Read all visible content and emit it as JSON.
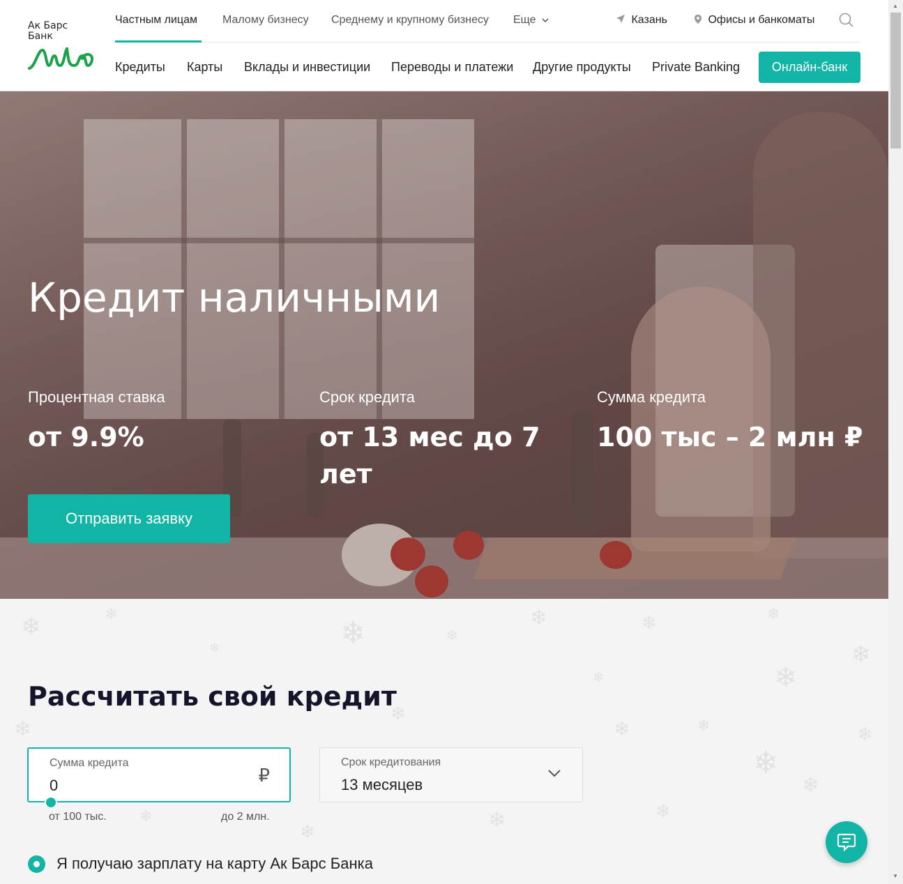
{
  "logo": {
    "line1": "Ак Барс",
    "line2": "Банк"
  },
  "top_nav": {
    "items": [
      "Частным лицам",
      "Малому бизнесу",
      "Среднему и крупному бизнесу",
      "Еще"
    ],
    "city": "Казань",
    "offices": "Офисы и банкоматы"
  },
  "main_nav": {
    "items": [
      "Кредиты",
      "Карты",
      "Вклады и инвестиции",
      "Переводы и платежи",
      "Другие продукты",
      "Private Banking"
    ],
    "online_bank": "Онлайн-банк"
  },
  "hero": {
    "title": "Кредит наличными",
    "stats": [
      {
        "label": "Процентная ставка",
        "value": "от 9.9%"
      },
      {
        "label": "Срок кредита",
        "value": "от 13 мес до 7 лет"
      },
      {
        "label": "Сумма кредита",
        "value": "100 тыс – 2 млн ₽"
      }
    ],
    "apply_button": "Отправить заявку"
  },
  "calculator": {
    "title": "Рассчитать свой кредит",
    "sum_label": "Сумма кредита",
    "sum_value": "0",
    "currency": "₽",
    "term_label": "Срок кредитования",
    "term_value": "13 месяцев",
    "range_min": "от 100 тыс.",
    "range_max": "до 2 млн.",
    "salary_option": "Я получаю зарплату на карту Ак Барс Банка"
  },
  "colors": {
    "accent": "#12b5a5",
    "heading": "#14142b"
  }
}
